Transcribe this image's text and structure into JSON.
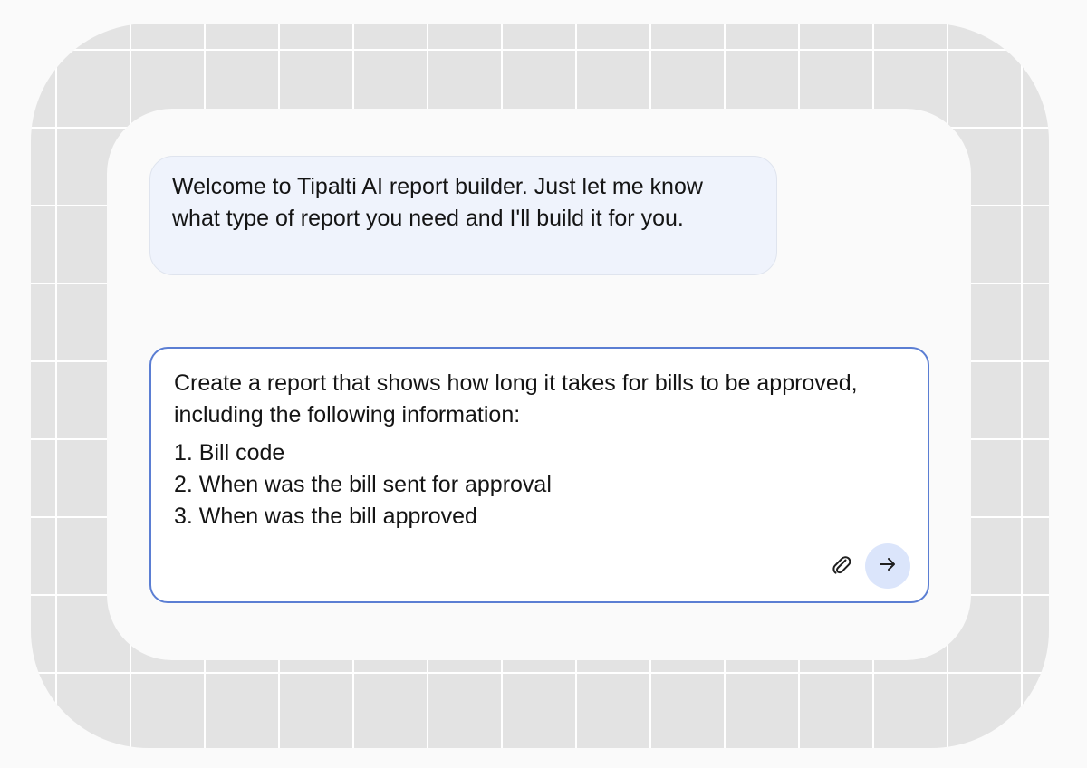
{
  "chat": {
    "bot_message": "Welcome to Tipalti AI report builder. Just let me know what type of report you need and I'll build it for you."
  },
  "prompt": {
    "intro": "Create a report that shows how long it takes for bills to be approved, including the following information:",
    "items": [
      "1. Bill code",
      "2. When was the bill sent for approval",
      "3. When was the bill approved"
    ]
  },
  "icons": {
    "attach": "paperclip-icon",
    "send": "arrow-right-icon"
  },
  "colors": {
    "page_background": "#fafafa",
    "grid_fill": "#e3e3e3",
    "grid_lines": "#ffffff",
    "bot_bubble": "#eff3fc",
    "input_border": "#5b7ed3",
    "send_button": "#dbe5fb",
    "text": "#141414"
  }
}
